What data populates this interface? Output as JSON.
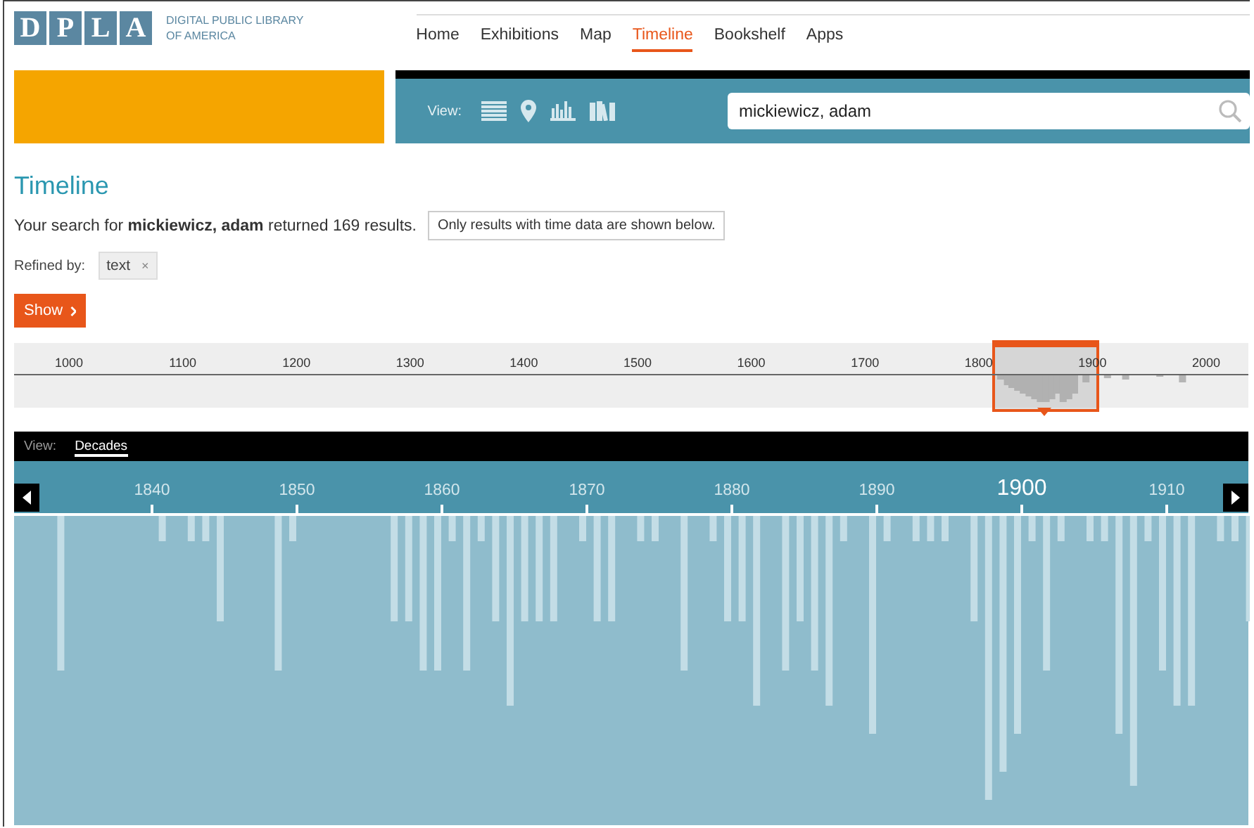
{
  "logo": {
    "letters": [
      "D",
      "P",
      "L",
      "A"
    ],
    "name_lines": [
      "DIGITAL PUBLIC LIBRARY",
      "OF AMERICA"
    ]
  },
  "nav": [
    {
      "label": "Home",
      "selected": false
    },
    {
      "label": "Exhibitions",
      "selected": false
    },
    {
      "label": "Map",
      "selected": false
    },
    {
      "label": "Timeline",
      "selected": true
    },
    {
      "label": "Bookshelf",
      "selected": false
    },
    {
      "label": "Apps",
      "selected": false
    }
  ],
  "search_panel": {
    "view_label": "View:",
    "views": [
      {
        "kind": "list"
      },
      {
        "kind": "map"
      },
      {
        "kind": "timeline"
      },
      {
        "kind": "bookshelf"
      }
    ],
    "query": "mickiewicz, adam"
  },
  "heading": "Timeline",
  "summary": "Your search for **mickiewicz, adam** returned 169 results.",
  "notice": "Only results with time data are shown below.",
  "refined_label": "Refined by:",
  "filters": [
    {
      "label": "text",
      "remove": "×"
    }
  ],
  "show_button": {
    "label": "Show"
  },
  "overview": {
    "ticks": [
      "1000",
      "1100",
      "1200",
      "1300",
      "1400",
      "1500",
      "1600",
      "1700",
      "1800",
      "1900",
      "2000"
    ]
  },
  "detail": {
    "view_label": "View:",
    "modes": [
      {
        "label": "Decades",
        "selected": true
      }
    ],
    "ticks": [
      {
        "label": "1840",
        "major": false
      },
      {
        "label": "1850",
        "major": false
      },
      {
        "label": "1860",
        "major": false
      },
      {
        "label": "1870",
        "major": false
      },
      {
        "label": "1880",
        "major": false
      },
      {
        "label": "1890",
        "major": false
      },
      {
        "label": "1900",
        "major": true
      },
      {
        "label": "1910",
        "major": false
      }
    ]
  }
}
